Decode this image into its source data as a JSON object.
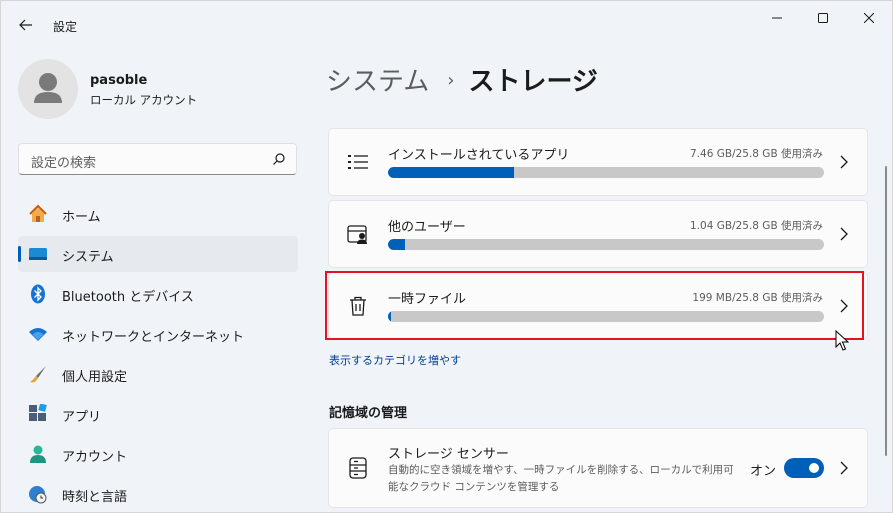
{
  "window": {
    "title": "設定"
  },
  "profile": {
    "name": "pasoble",
    "account_type": "ローカル アカウント"
  },
  "search": {
    "placeholder": "設定の検索"
  },
  "sidebar": {
    "items": [
      {
        "label": "ホーム",
        "icon": "home-icon",
        "active": false
      },
      {
        "label": "システム",
        "icon": "system-icon",
        "active": true
      },
      {
        "label": "Bluetooth とデバイス",
        "icon": "bluetooth-icon",
        "active": false
      },
      {
        "label": "ネットワークとインターネット",
        "icon": "wifi-icon",
        "active": false
      },
      {
        "label": "個人用設定",
        "icon": "brush-icon",
        "active": false
      },
      {
        "label": "アプリ",
        "icon": "apps-icon",
        "active": false
      },
      {
        "label": "アカウント",
        "icon": "account-icon",
        "active": false
      },
      {
        "label": "時刻と言語",
        "icon": "globe-clock-icon",
        "active": false
      }
    ]
  },
  "breadcrumb": {
    "parent": "システム",
    "separator": "›",
    "current": "ストレージ"
  },
  "storage_items": [
    {
      "title": "インストールされているアプリ",
      "usage": "7.46 GB/25.8 GB 使用済み",
      "fraction": 0.289,
      "icon": "list-icon"
    },
    {
      "title": "他のユーザー",
      "usage": "1.04 GB/25.8 GB 使用済み",
      "fraction": 0.04,
      "icon": "other-users-icon"
    },
    {
      "title": "一時ファイル",
      "usage": "199 MB/25.8 GB 使用済み",
      "fraction": 0.0077,
      "icon": "trash-icon"
    }
  ],
  "more_categories_link": "表示するカテゴリを増やす",
  "management": {
    "section_title": "記憶域の管理",
    "storage_sense": {
      "title": "ストレージ センサー",
      "description": "自動的に空き領域を増やす、一時ファイルを削除する、ローカルで利用可能なクラウド コンテンツを管理する",
      "toggle_label": "オン",
      "toggle_on": true
    }
  },
  "colors": {
    "accent": "#005fb8",
    "highlight_border": "#e81123"
  }
}
